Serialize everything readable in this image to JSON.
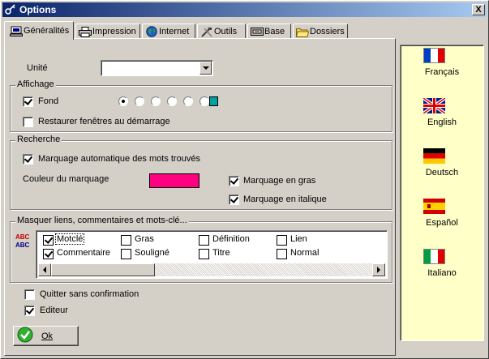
{
  "window": {
    "title": "Options",
    "close_label": "X"
  },
  "tabs": [
    {
      "label": "Généralités",
      "icon": "computer-icon",
      "active": true
    },
    {
      "label": "Impression",
      "icon": "printer-icon"
    },
    {
      "label": "Internet",
      "icon": "globe-icon"
    },
    {
      "label": "Outils",
      "icon": "tools-icon"
    },
    {
      "label": "Base",
      "icon": "database-icon"
    },
    {
      "label": "Dossiers",
      "icon": "folder-icon"
    }
  ],
  "general": {
    "unit_label": "Unité",
    "unit_value": ""
  },
  "affichage": {
    "title": "Affichage",
    "fond_label": "Fond",
    "fond_checked": true,
    "radio_count": 6,
    "radio_selected": 0,
    "fond_color": "#00a0a0",
    "restaurer_label": "Restaurer fenêtres au démarrage",
    "restaurer_checked": false
  },
  "recherche": {
    "title": "Recherche",
    "marquage_auto_label": "Marquage automatique des mots trouvés",
    "marquage_auto_checked": true,
    "couleur_label": "Couleur du marquage",
    "couleur_value": "#ff0080",
    "gras_label": "Marquage en gras",
    "gras_checked": true,
    "italique_label": "Marquage en italique",
    "italique_checked": true
  },
  "masquer": {
    "title": "Masquer liens, commentaires et mots-clé...",
    "items": [
      {
        "label": "Motclé",
        "checked": true
      },
      {
        "label": "Gras",
        "checked": false
      },
      {
        "label": "Définition",
        "checked": false
      },
      {
        "label": "Lien",
        "checked": false
      },
      {
        "label": "Commentaire",
        "checked": true
      },
      {
        "label": "Souligné",
        "checked": false
      },
      {
        "label": "Titre",
        "checked": false
      },
      {
        "label": "Normal",
        "checked": false
      }
    ]
  },
  "bottom": {
    "quitter_label": "Quitter sans confirmation",
    "quitter_checked": false,
    "editeur_label": "Editeur",
    "editeur_checked": true,
    "ok_label": "Ok"
  },
  "languages": [
    {
      "label": "Français",
      "flag": "france-flag-icon"
    },
    {
      "label": "English",
      "flag": "uk-flag-icon"
    },
    {
      "label": "Deutsch",
      "flag": "germany-flag-icon"
    },
    {
      "label": "Español",
      "flag": "spain-flag-icon"
    },
    {
      "label": "Italiano",
      "flag": "italy-flag-icon"
    }
  ]
}
